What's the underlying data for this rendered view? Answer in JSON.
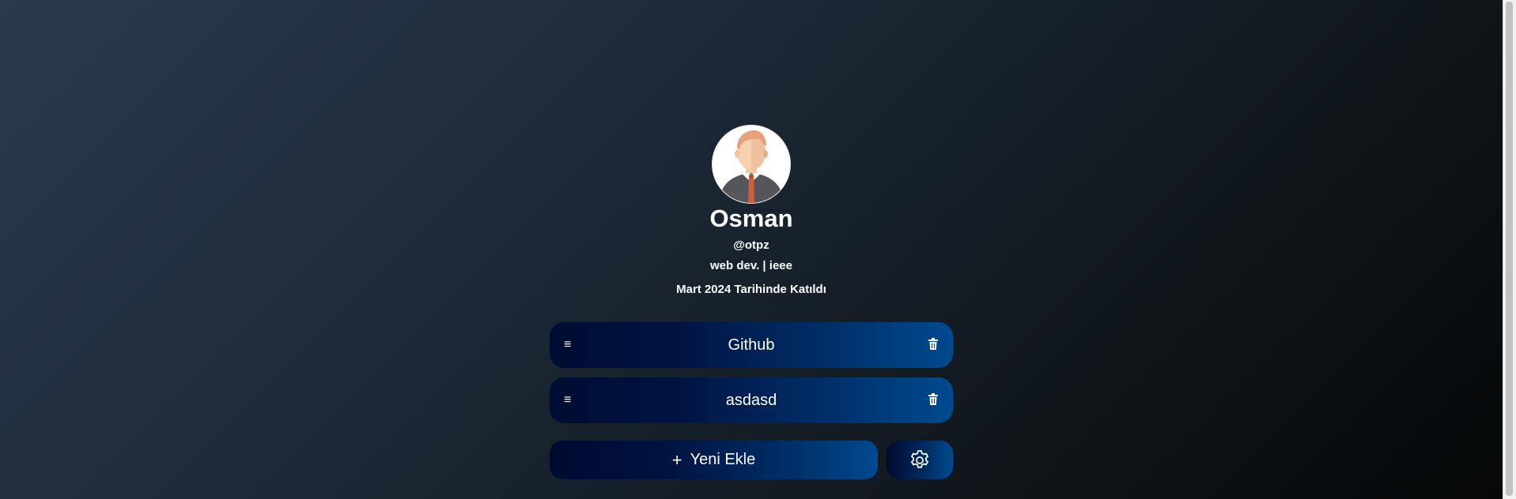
{
  "profile": {
    "name": "Osman",
    "handle": "@otpz",
    "bio": "web dev. | ieee",
    "joined": "Mart 2024 Tarihinde Katıldı",
    "avatar_icon": "man-avatar-icon"
  },
  "links": [
    {
      "title": "Github",
      "drag_icon": "≡",
      "delete_icon": "trash-icon"
    },
    {
      "title": "asdasd",
      "drag_icon": "≡",
      "delete_icon": "trash-icon"
    }
  ],
  "actions": {
    "add_icon": "+",
    "add_label": "Yeni Ekle",
    "settings_icon": "gear-icon"
  },
  "colors": {
    "background_start": "#2a3b4e",
    "background_end": "#050708",
    "button_start": "#000d33",
    "button_end": "#004a8f",
    "text": "#ffffff"
  }
}
